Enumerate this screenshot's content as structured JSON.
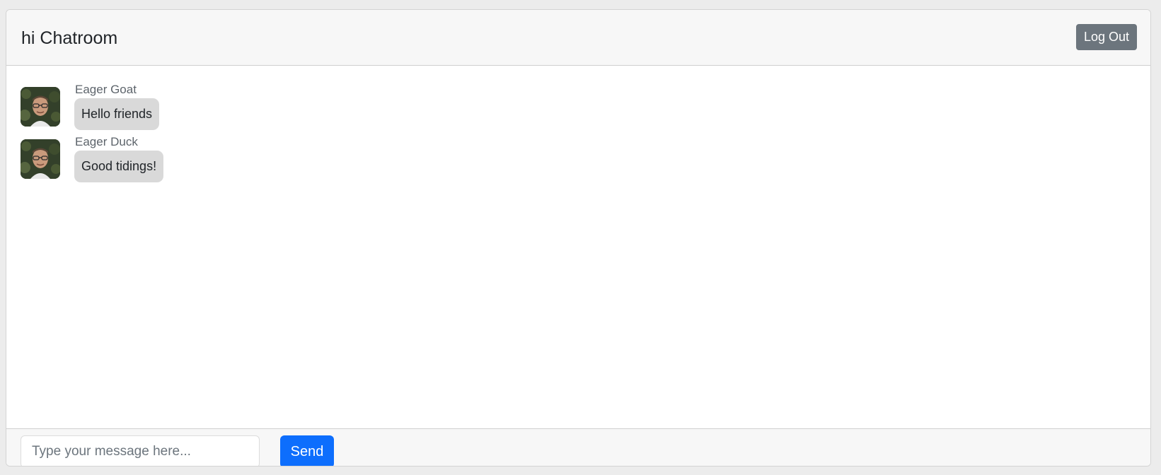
{
  "header": {
    "title": "hi Chatroom",
    "logout_label": "Log Out"
  },
  "messages": [
    {
      "author": "Eager Goat",
      "text": "Hello friends",
      "avatar_icon": "user-photo-icon"
    },
    {
      "author": "Eager Duck",
      "text": "Good tidings!",
      "avatar_icon": "user-photo-icon"
    }
  ],
  "composer": {
    "placeholder": "Type your message here...",
    "value": "",
    "send_label": "Send"
  },
  "colors": {
    "primary": "#0d6efd",
    "secondary": "#6c757d",
    "bubble": "#d9d9d9",
    "header_bg": "#f7f7f7"
  }
}
